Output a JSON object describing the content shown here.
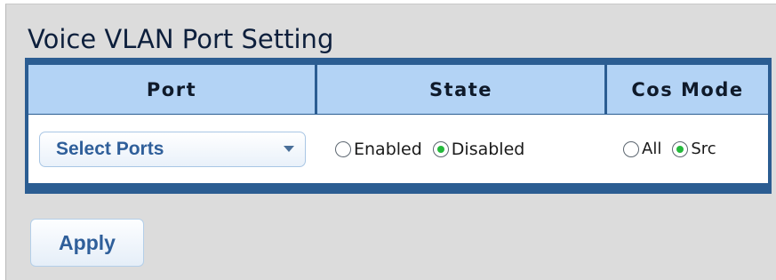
{
  "page": {
    "title": "Voice VLAN Port Setting"
  },
  "table": {
    "headers": {
      "port": "Port",
      "state": "State",
      "cos_mode": "Cos Mode"
    },
    "port_select": {
      "value": "Select Ports"
    },
    "state_options": [
      {
        "label": "Enabled",
        "checked": false
      },
      {
        "label": "Disabled",
        "checked": true
      }
    ],
    "cos_options": [
      {
        "label": "All",
        "checked": false
      },
      {
        "label": "Src",
        "checked": true
      }
    ]
  },
  "actions": {
    "apply_label": "Apply"
  },
  "colors": {
    "table_border": "#2b5d92",
    "header_bg": "#b3d3f5",
    "panel_bg": "#dcdcdc",
    "radio_dot": "#24b93b",
    "button_text": "#2f5f9a"
  }
}
